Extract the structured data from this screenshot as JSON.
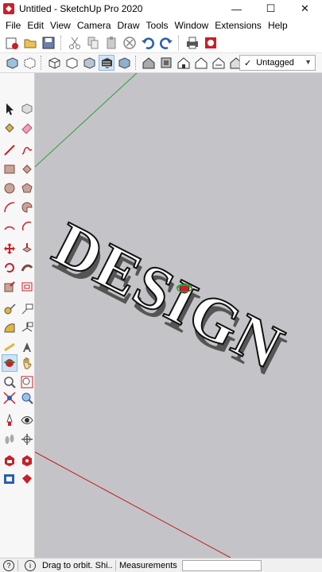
{
  "window": {
    "title": "Untitled - SketchUp Pro 2020",
    "min_glyph": "—",
    "max_glyph": "☐",
    "close_glyph": "✕"
  },
  "menu": [
    "File",
    "Edit",
    "View",
    "Camera",
    "Draw",
    "Tools",
    "Window",
    "Extensions",
    "Help"
  ],
  "toolbar_top": [
    "new-model-icon",
    "open-icon",
    "save-icon",
    "cut-icon",
    "copy-icon",
    "paste-icon",
    "erase-icon",
    "undo-icon",
    "redo-icon",
    "print-icon",
    "model-info-icon"
  ],
  "toolbar_styles": [
    "xray-icon",
    "back-edges-icon",
    "wireframe-icon",
    "hidden-line-icon",
    "shaded-icon",
    "shaded-textures-icon",
    "monochrome-icon",
    "iso-view-icon",
    "top-view-icon",
    "front-view-icon",
    "right-view-icon",
    "back-view-icon",
    "left-view-icon"
  ],
  "tag": {
    "check": "✓",
    "value": "Untagged"
  },
  "left_tools": [
    "select",
    "component",
    "paint",
    "eraser",
    "line",
    "freehand",
    "rectangle",
    "rotated-rect",
    "circle",
    "polygon",
    "arc",
    "pie",
    "arc-2pt",
    "arc-3pt",
    "move",
    "push-pull",
    "rotate",
    "follow-me",
    "scale",
    "offset",
    "tape",
    "text",
    "protractor",
    "axes",
    "dimension",
    "3d-text",
    "orbit",
    "pan",
    "zoom",
    "zoom-window",
    "zoom-extents",
    "previous-view",
    "position-camera",
    "look-around",
    "walk",
    "section-plane",
    "warehouse",
    "extension-warehouse",
    "send-to-layout",
    "ruby"
  ],
  "viewport": {
    "text": "DESIGN",
    "bg": "#c4c4c8"
  },
  "status": {
    "hint": "Drag to orbit. Shi...",
    "measurements_label": "Measurements",
    "info_glyph": "i",
    "geo_glyph": "?"
  }
}
